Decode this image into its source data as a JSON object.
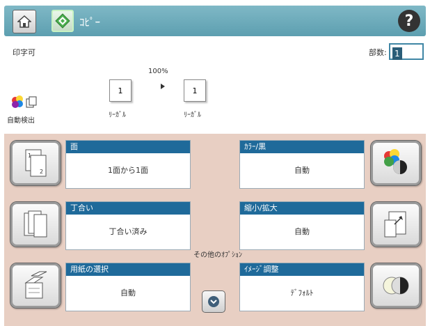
{
  "header": {
    "title": "ｺﾋﾟｰ",
    "home_icon": "home-icon",
    "app_icon": "copy-start-icon",
    "help_icon": "help-icon",
    "help_glyph": "?"
  },
  "status": {
    "text": "印字可"
  },
  "copies": {
    "label": "部数:",
    "value": "1"
  },
  "preview": {
    "zoom": "100%",
    "original": {
      "page": "1",
      "size": "ﾘｰｶﾞﾙ"
    },
    "output": {
      "page": "1",
      "size": "ﾘｰｶﾞﾙ"
    },
    "color_mode_icon": "color-auto-icon",
    "color_mode_label": "自動検出"
  },
  "options": {
    "sides": {
      "title": "面",
      "value": "1面から1面",
      "icon": "two-sided-icon"
    },
    "collate": {
      "title": "丁合い",
      "value": "丁合い済み",
      "icon": "collate-icon"
    },
    "paper": {
      "title": "用紙の選択",
      "value": "自動",
      "icon": "paper-select-icon"
    },
    "color": {
      "title": "ｶﾗｰ/黒",
      "value": "自動",
      "icon": "color-black-icon"
    },
    "reduce": {
      "title": "縮小/拡大",
      "value": "自動",
      "icon": "reduce-enlarge-icon"
    },
    "image": {
      "title": "ｲﾒｰｼﾞ調整",
      "value": "ﾃﾞﾌｫﾙﾄ",
      "icon": "image-adjust-icon"
    }
  },
  "other_options_label": "その他のｵﾌﾟｼｮﾝ",
  "more_icon": "chevron-down-icon"
}
